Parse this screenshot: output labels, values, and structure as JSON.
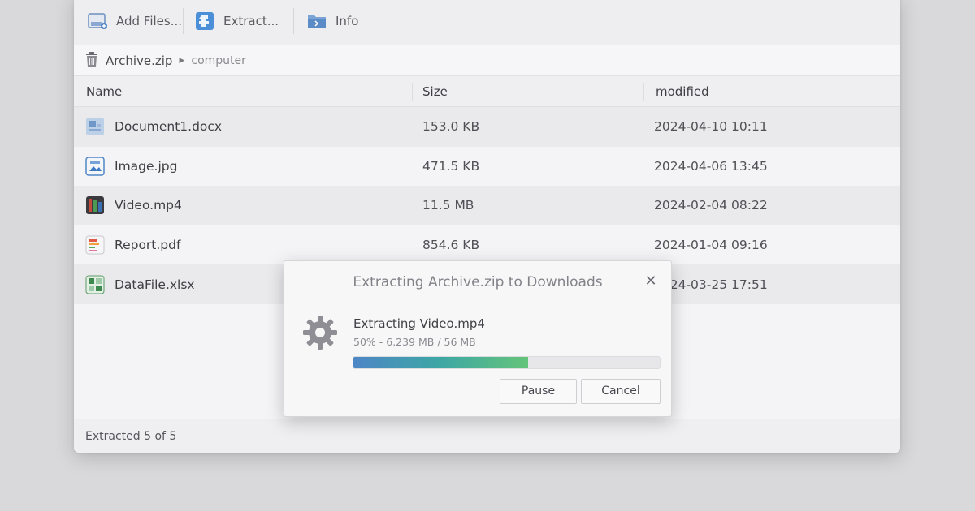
{
  "toolbar": {
    "add_files": "Add Files...",
    "extract": "Extract...",
    "info": "Info"
  },
  "breadcrumb": {
    "root": "Archive.zip",
    "sub": "computer"
  },
  "columns": {
    "name": "Name",
    "size": "Size",
    "modified": "modified"
  },
  "files": [
    {
      "name": "Document1.docx",
      "size": "153.0 KB",
      "modified": "2024-04-10 10:11",
      "icon": "docx-file-icon"
    },
    {
      "name": "Image.jpg",
      "size": "471.5 KB",
      "modified": "2024-04-06 13:45",
      "icon": "image-file-icon"
    },
    {
      "name": "Video.mp4",
      "size": "11.5 MB",
      "modified": "2024-02-04 08:22",
      "icon": "video-file-icon"
    },
    {
      "name": "Report.pdf",
      "size": "854.6 KB",
      "modified": "2024-01-04 09:16",
      "icon": "pdf-file-icon"
    },
    {
      "name": "DataFile.xlsx",
      "size": "",
      "modified": "2024-03-25 17:51",
      "icon": "spreadsheet-file-icon"
    }
  ],
  "status": {
    "text": "Extracted 5 of 5"
  },
  "dialog": {
    "title": "Extracting Archive.zip to Downloads",
    "close": "✕",
    "current_file": "Extracting Video.mp4",
    "progress_text": "50% - 6.239 MB / 56 MB",
    "progress": 0.57,
    "pause": "Pause",
    "cancel": "Cancel"
  },
  "colors": {
    "progress_start": "#4d86c6",
    "progress_end": "#64c47a",
    "window_bg": "#f4f4f6"
  }
}
